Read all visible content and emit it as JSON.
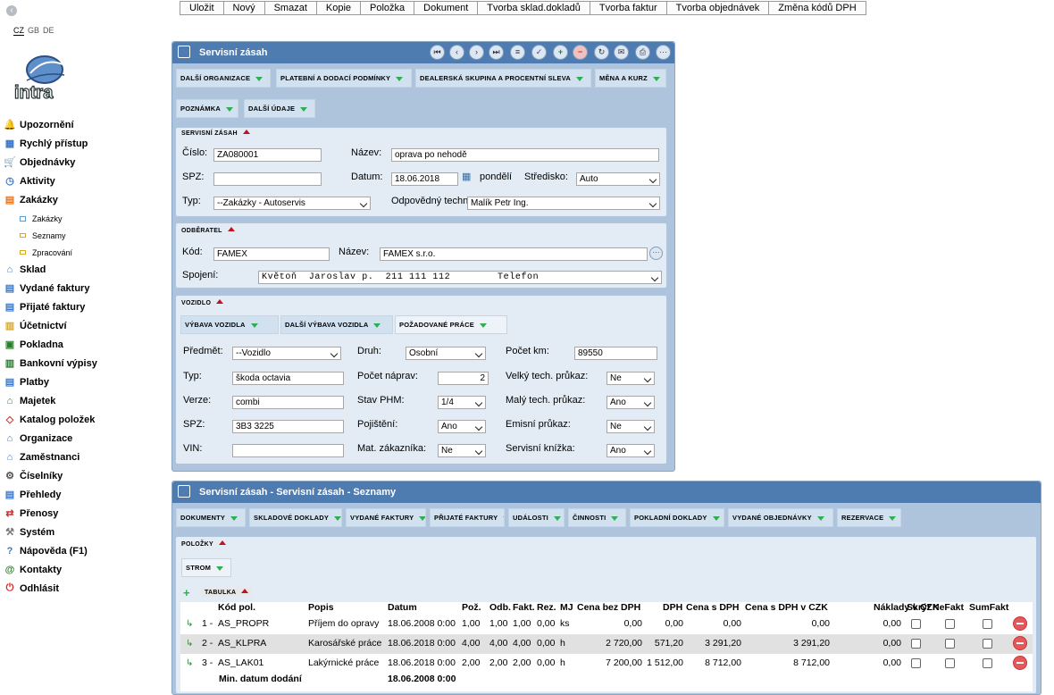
{
  "toolbar": [
    "Uložit",
    "Nový",
    "Smazat",
    "Kopie",
    "Položka",
    "Dokument",
    "Tvorba sklad.dokladů",
    "Tvorba faktur",
    "Tvorba objednávek",
    "Změna kódů DPH"
  ],
  "langs": [
    "CZ",
    "GB",
    "DE"
  ],
  "logo_text": "intra",
  "nav": [
    {
      "label": "Upozornění",
      "icon": "bell-icon"
    },
    {
      "label": "Rychlý přístup",
      "icon": "tiles-icon"
    },
    {
      "label": "Objednávky",
      "icon": "cart-icon"
    },
    {
      "label": "Aktivity",
      "icon": "clock-icon"
    },
    {
      "label": "Zakázky",
      "icon": "orders-icon"
    },
    {
      "label": "Sklad",
      "icon": "warehouse-icon"
    },
    {
      "label": "Vydané faktury",
      "icon": "invoice-out-icon"
    },
    {
      "label": "Přijaté faktury",
      "icon": "invoice-in-icon"
    },
    {
      "label": "Účetnictví",
      "icon": "ledger-icon"
    },
    {
      "label": "Pokladna",
      "icon": "cashbox-icon"
    },
    {
      "label": "Bankovní výpisy",
      "icon": "bank-icon"
    },
    {
      "label": "Platby",
      "icon": "payment-icon"
    },
    {
      "label": "Majetek",
      "icon": "assets-icon"
    },
    {
      "label": "Katalog položek",
      "icon": "catalog-icon"
    },
    {
      "label": "Organizace",
      "icon": "organization-icon"
    },
    {
      "label": "Zaměstnanci",
      "icon": "employees-icon"
    },
    {
      "label": "Číselníky",
      "icon": "gear-icon"
    },
    {
      "label": "Přehledy",
      "icon": "overview-icon"
    },
    {
      "label": "Přenosy",
      "icon": "transfer-icon"
    },
    {
      "label": "Systém",
      "icon": "wrench-icon"
    },
    {
      "label": "Nápověda (F1)",
      "icon": "help-icon"
    },
    {
      "label": "Kontakty",
      "icon": "at-icon"
    },
    {
      "label": "Odhlásit",
      "icon": "power-icon"
    }
  ],
  "subnav": [
    "Zakázky",
    "Seznamy",
    "Zpracování"
  ],
  "form": {
    "title": "Servisní zásah",
    "tabs": [
      "DALŠÍ ORGANIZACE",
      "PLATEBNÍ A DODACÍ PODMÍNKY",
      "DEALERSKÁ SKUPINA A PROCENTNÍ SLEVA",
      "MĚNA A KURZ",
      "POZNÁMKA",
      "DALŠÍ ÚDAJE"
    ],
    "sec1": {
      "header": "SERVISNÍ ZÁSAH",
      "cislo_label": "Číslo:",
      "cislo": "ZA080001",
      "nazev_label": "Název:",
      "nazev": "oprava po nehodě",
      "spz_label": "SPZ:",
      "spz": "",
      "datum_label": "Datum:",
      "datum": "18.06.2018",
      "den": "pondělí",
      "stredisko_label": "Středisko:",
      "stredisko": "Auto",
      "typ_label": "Typ:",
      "typ": "--Zakázky - Autoservis",
      "technik_label": "Odpovědný techn",
      "technik": "Malík Petr Ing."
    },
    "sec2": {
      "header": "ODBĚRATEL",
      "kod_label": "Kód:",
      "kod": "FAMEX",
      "nazev_label": "Název:",
      "nazev": "FAMEX s.r.o.",
      "spojeni_label": "Spojení:",
      "spojeni": "Květoň  Jaroslav p.  211 111 112        Telefon"
    },
    "sec3": {
      "header": "VOZIDLO",
      "tabs": [
        "VÝBAVA VOZIDLA",
        "DALŠÍ VÝBAVA VOZIDLA",
        "POŽADOVANÉ PRÁCE"
      ],
      "predmet_label": "Předmět:",
      "predmet": "--Vozidlo",
      "druh_label": "Druh:",
      "druh": "Osobní",
      "km_label": "Počet km:",
      "km": "89550",
      "typ_label": "Typ:",
      "typ": "škoda octavia",
      "naprav_label": "Počet náprav:",
      "naprav": "2",
      "velky_label": "Velký tech. průkaz:",
      "velky": "Ne",
      "verze_label": "Verze:",
      "verze": "combi",
      "phm_label": "Stav PHM:",
      "phm": "1/4",
      "maly_label": "Malý tech. průkaz:",
      "maly": "Ano",
      "spz_label": "SPZ:",
      "spz": "3B3 3225",
      "pojisteni_label": "Pojištění:",
      "pojisteni": "Ano",
      "emisni_label": "Emisní průkaz:",
      "emisni": "Ne",
      "vin_label": "VIN:",
      "vin": "",
      "mat_label": "Mat. zákazníka:",
      "mat": "Ne",
      "knizka_label": "Servisní knížka:",
      "knizka": "Ano"
    }
  },
  "list": {
    "title": "Servisní zásah - Servisní zásah - Seznamy",
    "tabs": [
      "DOKUMENTY",
      "SKLADOVÉ DOKLADY",
      "VYDANÉ FAKTURY",
      "PŘIJATÉ FAKTURY",
      "UDÁLOSTI",
      "ČINNOSTI",
      "POKLADNÍ DOKLADY",
      "VYDANÉ OBJEDNÁVKY",
      "REZERVACE"
    ],
    "polozky": "POLOŽKY",
    "strom": "STROM",
    "tabulka": "TABULKA",
    "columns": [
      "Kód pol.",
      "Popis",
      "Datum",
      "Pož.",
      "Odb.",
      "Fakt.",
      "Rez.",
      "MJ",
      "Cena bez DPH",
      "DPH",
      "Cena s DPH",
      "Cena s DPH v CZK",
      "Náklady v CZK",
      "Skrýt",
      "NeFakt",
      "SumFakt"
    ],
    "rows": [
      {
        "no": "1 -",
        "kod": "AS_PROPR",
        "popis": "Příjem do opravy",
        "datum": "18.06.2008 0:00",
        "poz": "1,00",
        "odb": "1,00",
        "fakt": "1,00",
        "rez": "0,00",
        "mj": "ks",
        "cena": "0,00",
        "dph": "0,00",
        "cenas": "0,00",
        "czk": "0,00",
        "nakl": "0,00"
      },
      {
        "no": "2 -",
        "kod": "AS_KLPRA",
        "popis": "Karosářské práce",
        "datum": "18.06.2018 0:00",
        "poz": "4,00",
        "odb": "4,00",
        "fakt": "4,00",
        "rez": "0,00",
        "mj": "h",
        "cena": "2 720,00",
        "dph": "571,20",
        "cenas": "3 291,20",
        "czk": "3 291,20",
        "nakl": "0,00"
      },
      {
        "no": "3 -",
        "kod": "AS_LAK01",
        "popis": "Lakýrnické práce",
        "datum": "18.06.2018 0:00",
        "poz": "2,00",
        "odb": "2,00",
        "fakt": "2,00",
        "rez": "0,00",
        "mj": "h",
        "cena": "7 200,00",
        "dph": "1 512,00",
        "cenas": "8 712,00",
        "czk": "8 712,00",
        "nakl": "0,00"
      }
    ],
    "footer_label": "Min. datum dodání",
    "footer_value": "18.06.2008 0:00"
  },
  "colors": {
    "title_bar": "#4e7bb0",
    "panel": "#adc4dc",
    "section": "#e3ecf5",
    "tab": "#d2e1ef",
    "accent_green": "#2fae52",
    "accent_red": "#c2121f"
  }
}
